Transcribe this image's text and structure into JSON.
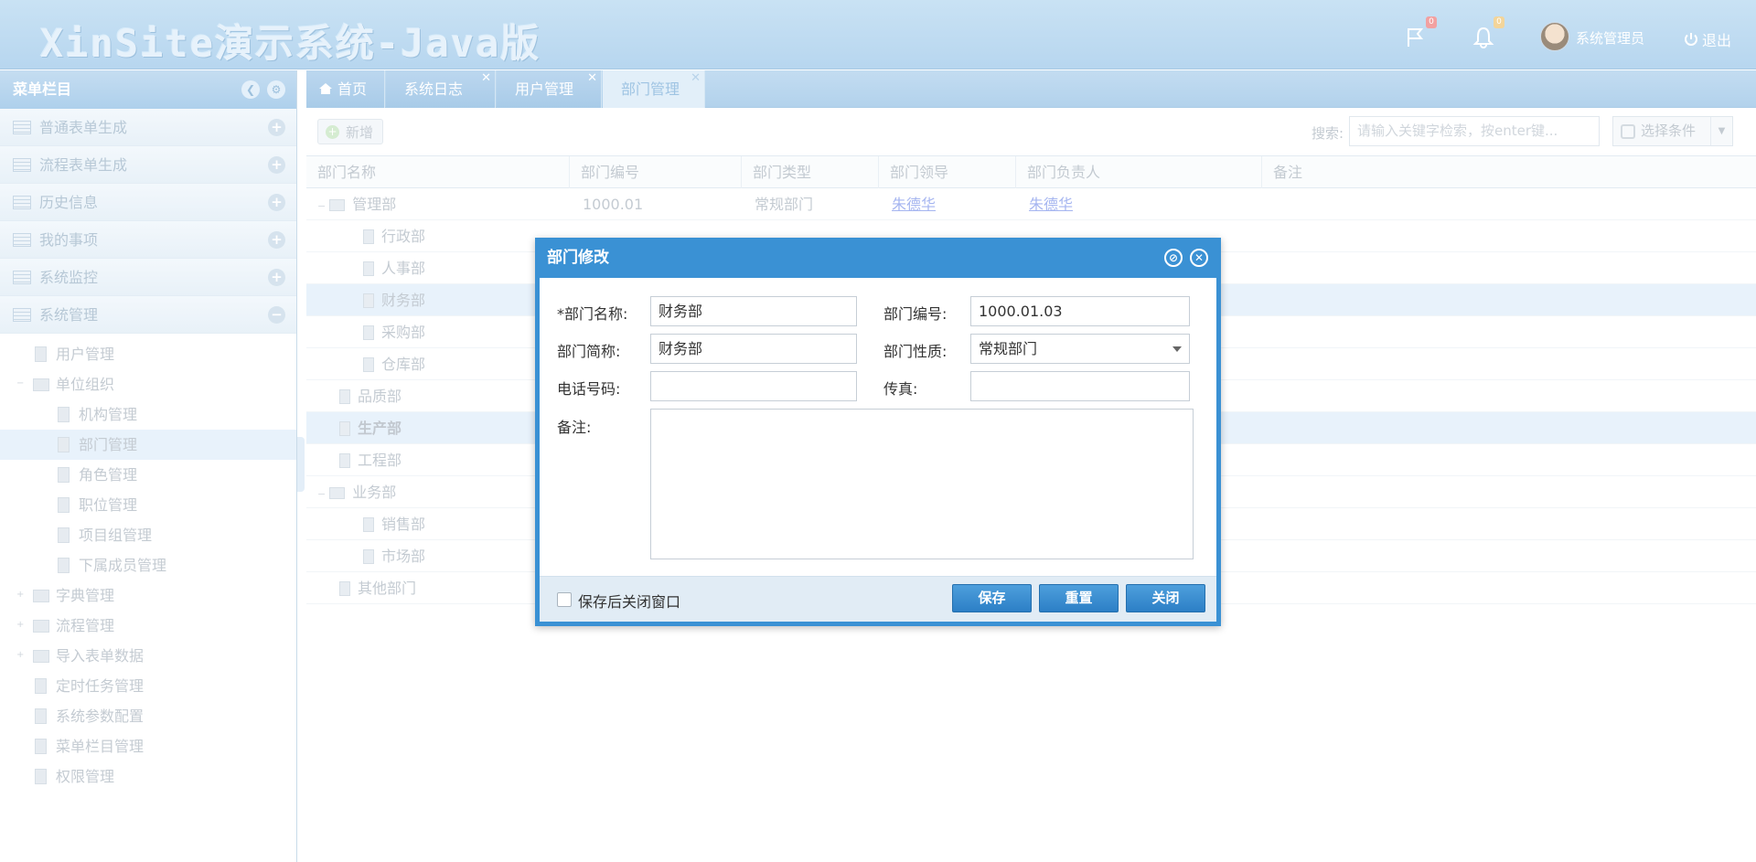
{
  "header": {
    "title": "XinSite演示系统-Java版",
    "flag_badge": "0",
    "bell_badge": "0",
    "user_name": "系统管理员",
    "logout": "退出"
  },
  "sidebar": {
    "title": "菜单栏目",
    "accordions": [
      "普通表单生成",
      "流程表单生成",
      "历史信息",
      "我的事项",
      "系统监控",
      "系统管理"
    ],
    "tree": [
      {
        "label": "用户管理"
      },
      {
        "label": "单位组织"
      },
      {
        "label": "机构管理"
      },
      {
        "label": "部门管理"
      },
      {
        "label": "角色管理"
      },
      {
        "label": "职位管理"
      },
      {
        "label": "项目组管理"
      },
      {
        "label": "下属成员管理"
      },
      {
        "label": "字典管理"
      },
      {
        "label": "流程管理"
      },
      {
        "label": "导入表单数据"
      },
      {
        "label": "定时任务管理"
      },
      {
        "label": "系统参数配置"
      },
      {
        "label": "菜单栏目管理"
      },
      {
        "label": "权限管理"
      }
    ]
  },
  "tabs": [
    "首页",
    "系统日志",
    "用户管理",
    "部门管理"
  ],
  "toolbar": {
    "add_label": "新增",
    "search_label": "搜索:",
    "search_placeholder": "请输入关键字检索，按enter键...",
    "condition_label": "选择条件"
  },
  "grid": {
    "columns": [
      "部门名称",
      "部门编号",
      "部门类型",
      "部门领导",
      "部门负责人",
      "备注"
    ],
    "rows": [
      {
        "name": "管理部",
        "code": "1000.01",
        "type": "常规部门",
        "leader": "朱德华",
        "head": "朱德华"
      },
      {
        "name": "行政部",
        "code": "",
        "type": "",
        "leader": "",
        "head": ""
      },
      {
        "name": "人事部",
        "code": "",
        "type": "",
        "leader": "",
        "head": ""
      },
      {
        "name": "财务部",
        "code": "",
        "type": "",
        "leader": "",
        "head": ""
      },
      {
        "name": "采购部",
        "code": "",
        "type": "",
        "leader": "",
        "head": ""
      },
      {
        "name": "仓库部",
        "code": "",
        "type": "",
        "leader": "",
        "head": ""
      },
      {
        "name": "品质部",
        "code": "",
        "type": "",
        "leader": "",
        "head": ""
      },
      {
        "name": "生产部",
        "code": "",
        "type": "",
        "leader": "",
        "head": ""
      },
      {
        "name": "工程部",
        "code": "",
        "type": "",
        "leader": "",
        "head": ""
      },
      {
        "name": "业务部",
        "code": "",
        "type": "",
        "leader": "",
        "head": ""
      },
      {
        "name": "销售部",
        "code": "",
        "type": "",
        "leader": "",
        "head": ""
      },
      {
        "name": "市场部",
        "code": "",
        "type": "",
        "leader": "",
        "head": ""
      },
      {
        "name": "其他部门",
        "code": "",
        "type": "",
        "leader": "",
        "head": ""
      }
    ]
  },
  "dialog": {
    "title": "部门修改",
    "name_label": "*部门名称:",
    "name_value": "财务部",
    "code_label": "部门编号:",
    "code_value": "1000.01.03",
    "short_label": "部门简称:",
    "short_value": "财务部",
    "nature_label": "部门性质:",
    "nature_value": "常规部门",
    "phone_label": "电话号码:",
    "phone_value": "",
    "fax_label": "传真:",
    "fax_value": "",
    "remark_label": "备注:",
    "close_after_save_label": "保存后关闭窗口",
    "save": "保存",
    "reset": "重置",
    "close": "关闭"
  },
  "colors": {
    "accent": "#3a91d4",
    "header_bg": "#bcd9f0",
    "link": "#a5b5f0"
  }
}
